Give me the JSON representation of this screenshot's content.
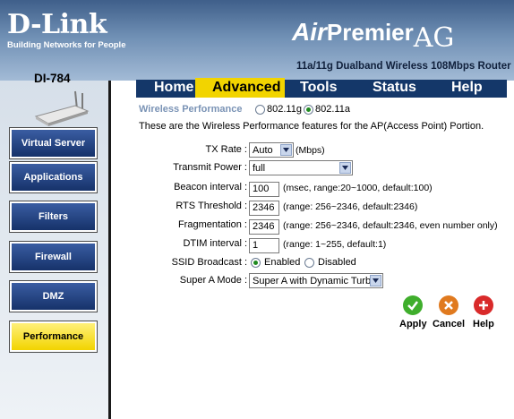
{
  "brand": {
    "name": "D-Link",
    "tagline": "Building Networks for People",
    "model": "DI-784",
    "product_air": "Air",
    "product_premier": "Premier",
    "product_ag": "AG",
    "router_desc": "11a/11g Dualband Wireless 108Mbps Router"
  },
  "sidebar": {
    "items": [
      {
        "label": "Virtual Server",
        "active": false
      },
      {
        "label": "Applications",
        "active": false
      },
      {
        "label": "Filters",
        "active": false
      },
      {
        "label": "Firewall",
        "active": false
      },
      {
        "label": "DMZ",
        "active": false
      },
      {
        "label": "Performance",
        "active": true
      }
    ]
  },
  "tabs": [
    {
      "label": "Home",
      "active": false
    },
    {
      "label": "Advanced",
      "active": true
    },
    {
      "label": "Tools",
      "active": false
    },
    {
      "label": "Status",
      "active": false
    },
    {
      "label": "Help",
      "active": false
    }
  ],
  "main": {
    "section_title": "Wireless Performance",
    "band_options": [
      "802.11g",
      "802.11a"
    ],
    "band_selected": "802.11a",
    "description": "These are the Wireless Performance features for the AP(Access Point) Portion.",
    "tx_rate": {
      "label": "TX Rate :",
      "value": "Auto",
      "unit": "(Mbps)"
    },
    "transmit_power": {
      "label": "Transmit Power :",
      "value": "full"
    },
    "beacon_interval": {
      "label": "Beacon interval :",
      "value": "100",
      "hint": "(msec, range:20~1000, default:100)"
    },
    "rts_threshold": {
      "label": "RTS Threshold :",
      "value": "2346",
      "hint": "(range: 256~2346, default:2346)"
    },
    "fragmentation": {
      "label": "Fragmentation :",
      "value": "2346",
      "hint": "(range: 256~2346, default:2346, even number only)"
    },
    "dtim_interval": {
      "label": "DTIM interval :",
      "value": "1",
      "hint": "(range: 1~255, default:1)"
    },
    "ssid_broadcast": {
      "label": "SSID Broadcast :",
      "options": [
        "Enabled",
        "Disabled"
      ],
      "selected": "Enabled"
    },
    "super_a_mode": {
      "label": "Super A Mode :",
      "value": "Super A with Dynamic Turbo"
    }
  },
  "actions": {
    "apply": "Apply",
    "cancel": "Cancel",
    "help": "Help"
  },
  "colors": {
    "header_dark": "#3f5f8a",
    "tab_bar": "#143769",
    "active_yellow": "#f2d400",
    "sidebar_button": "#1f3f7f",
    "apply_green": "#3fae2c",
    "cancel_orange": "#e07a1f",
    "help_red": "#d92a2a"
  }
}
